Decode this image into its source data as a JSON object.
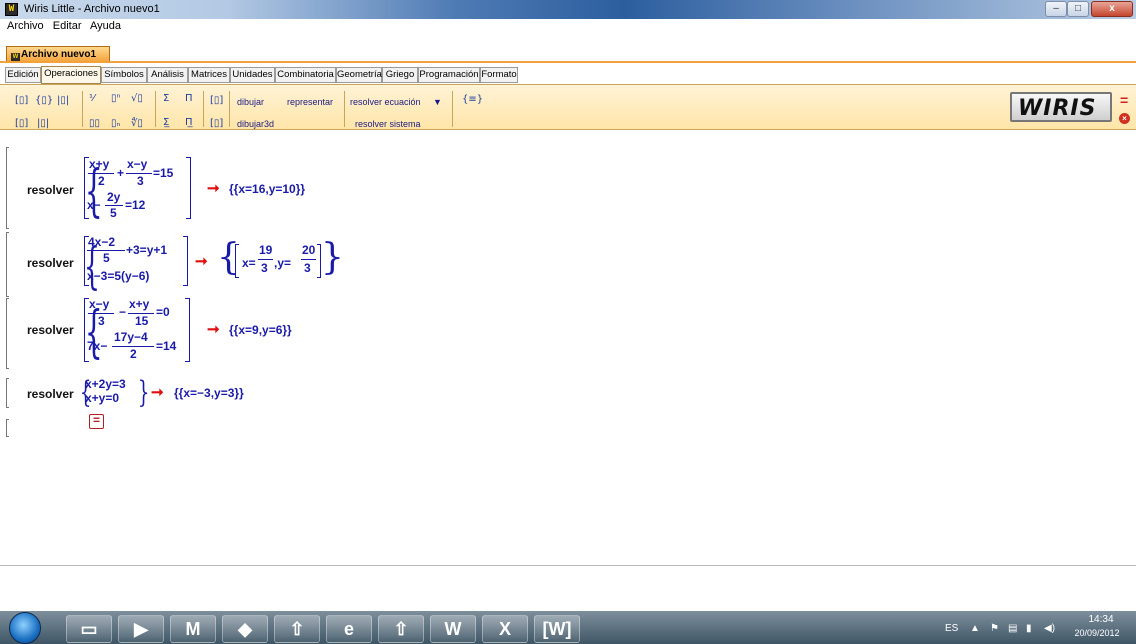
{
  "window": {
    "title": "Wiris Little - Archivo nuevo1",
    "app_icon": "wiris-app-icon",
    "min_label": "–",
    "max_label": "□",
    "close_label": "x"
  },
  "menu": [
    "Archivo",
    "Editar",
    "Ayuda"
  ],
  "document_tab": "Archivo nuevo1",
  "tabs": [
    "Edición",
    "Operaciones",
    "Símbolos",
    "Análisis",
    "Matrices",
    "Unidades",
    "Combinatoria",
    "Geometría",
    "Griego",
    "Programación",
    "Formato"
  ],
  "active_tab": "Operaciones",
  "toolbar": {
    "draw": "dibujar",
    "plot": "representar",
    "draw3d": "dibujar3d",
    "solve_equation": "resolver ecuación",
    "solve_system": "resolver sistema",
    "icons": [
      "paren-icon",
      "brace-icon",
      "abs-icon",
      "fraction-icon",
      "power-icon",
      "sqrt-icon",
      "sum-icon",
      "product-icon",
      "bracket-icon",
      "subscript-icon",
      "nroot-icon",
      "sum-limits-icon",
      "product-limits-icon",
      "bracket2-icon",
      "matrix-icon"
    ]
  },
  "logo": "WIRIS",
  "calc_symbol": "=",
  "close_symbol": "×",
  "equations": [
    {
      "cmd": "resolver",
      "result": "{{x=16,y=10}}"
    },
    {
      "cmd": "resolver",
      "result_x": "19",
      "result_x_den": "3",
      "result_y": "20",
      "result_y_den": "3"
    },
    {
      "cmd": "resolver",
      "result": "{{x=9,y=6}}"
    },
    {
      "cmd": "resolver",
      "result": "{{x=−3,y=3}}"
    }
  ],
  "math": {
    "e1_f1_num": "x+y",
    "e1_f1_den": "2",
    "e1_plus": "+",
    "e1_f2_num": "x−y",
    "e1_f2_den": "3",
    "e1_eq1_rhs": "=15",
    "e1_eq2_a": "x−",
    "e1_f3_num": "2y",
    "e1_f3_den": "5",
    "e1_eq2_rhs": "=12",
    "e2_f1_num": "4x−2",
    "e2_f1_den": "5",
    "e2_eq1_rest": "+3=y+1",
    "e2_eq2": "x−3=5(y−6)",
    "e2_res_x": "x=",
    "e2_res_sep": ",y=",
    "e3_f1_num": "x−y",
    "e3_f1_den": "3",
    "e3_minus": "−",
    "e3_f2_num": "x+y",
    "e3_f2_den": "15",
    "e3_eq1_rhs": "=0",
    "e3_eq2_a": "7x−",
    "e3_f3_num": "17y−4",
    "e3_f3_den": "2",
    "e3_eq2_rhs": "=14",
    "e4_eq1": "x+2y=3",
    "e4_eq2": "x+y=0"
  },
  "new_equation_button": "=",
  "taskbar": {
    "apps": [
      "explorer-icon",
      "media-icon",
      "mcafee-icon",
      "maps-icon",
      "updater-icon",
      "ie-icon",
      "updater2-icon",
      "word-icon",
      "excel-icon",
      "wiris-icon"
    ],
    "lang": "ES",
    "time": "14:34",
    "date": "20/09/2012"
  }
}
